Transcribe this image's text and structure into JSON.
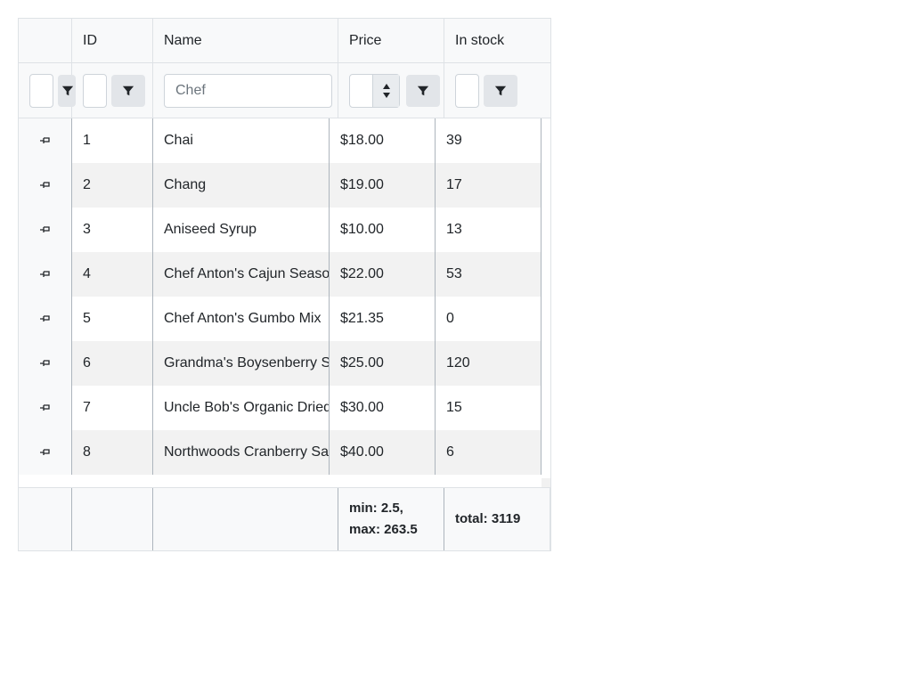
{
  "columns": {
    "id": "ID",
    "name": "Name",
    "price": "Price",
    "stock": "In stock"
  },
  "filters": {
    "id": {
      "value": ""
    },
    "name": {
      "value": "Chef"
    },
    "price": {
      "value": ""
    },
    "stock": {
      "value": ""
    }
  },
  "rows": [
    {
      "id": "1",
      "name": "Chai",
      "price": "$18.00",
      "stock": "39"
    },
    {
      "id": "2",
      "name": "Chang",
      "price": "$19.00",
      "stock": "17"
    },
    {
      "id": "3",
      "name": "Aniseed Syrup",
      "price": "$10.00",
      "stock": "13"
    },
    {
      "id": "4",
      "name": "Chef Anton's Cajun Seasoning",
      "price": "$22.00",
      "stock": "53"
    },
    {
      "id": "5",
      "name": "Chef Anton's Gumbo Mix",
      "price": "$21.35",
      "stock": "0"
    },
    {
      "id": "6",
      "name": "Grandma's Boysenberry Spread",
      "price": "$25.00",
      "stock": "120"
    },
    {
      "id": "7",
      "name": "Uncle Bob's Organic Dried Pears",
      "price": "$30.00",
      "stock": "15"
    },
    {
      "id": "8",
      "name": "Northwoods Cranberry Sauce",
      "price": "$40.00",
      "stock": "6"
    }
  ],
  "footer": {
    "price_line1": "min: 2.5,",
    "price_line2": "max: 263.5",
    "stock": "total: 3119"
  },
  "icons": {
    "filter": "filter-icon",
    "pin": "pin-icon",
    "spinner": "spinner-arrows-icon"
  },
  "colors": {
    "header_bg": "#f8f9fa",
    "row_alt_bg": "#f2f2f2",
    "filter_button_bg": "#e2e5e9"
  }
}
